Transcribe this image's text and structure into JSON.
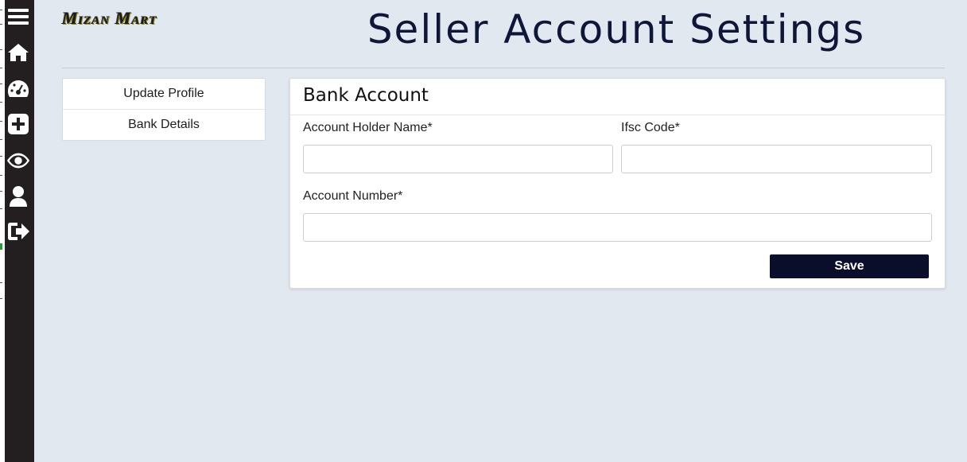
{
  "brand": {
    "logo_text": "Mizan Mart"
  },
  "header": {
    "title": "Seller Account Settings"
  },
  "rail": {
    "icons": [
      "menu-icon",
      "home-icon",
      "dashboard-icon",
      "add-icon",
      "eye-icon",
      "user-icon",
      "logout-icon"
    ]
  },
  "side_menu": {
    "items": [
      {
        "label": "Update Profile"
      },
      {
        "label": "Bank Details"
      }
    ]
  },
  "bank_form": {
    "title": "Bank Account",
    "holder_label": "Account Holder Name*",
    "holder_value": "",
    "ifsc_label": "Ifsc Code*",
    "ifsc_value": "",
    "number_label": "Account Number*",
    "number_value": "",
    "save_label": "Save"
  },
  "colors": {
    "page_bg": "#e1e8ef",
    "rail_bg": "#231f20",
    "title_color": "#10163a",
    "button_bg": "#0a0e2a"
  }
}
